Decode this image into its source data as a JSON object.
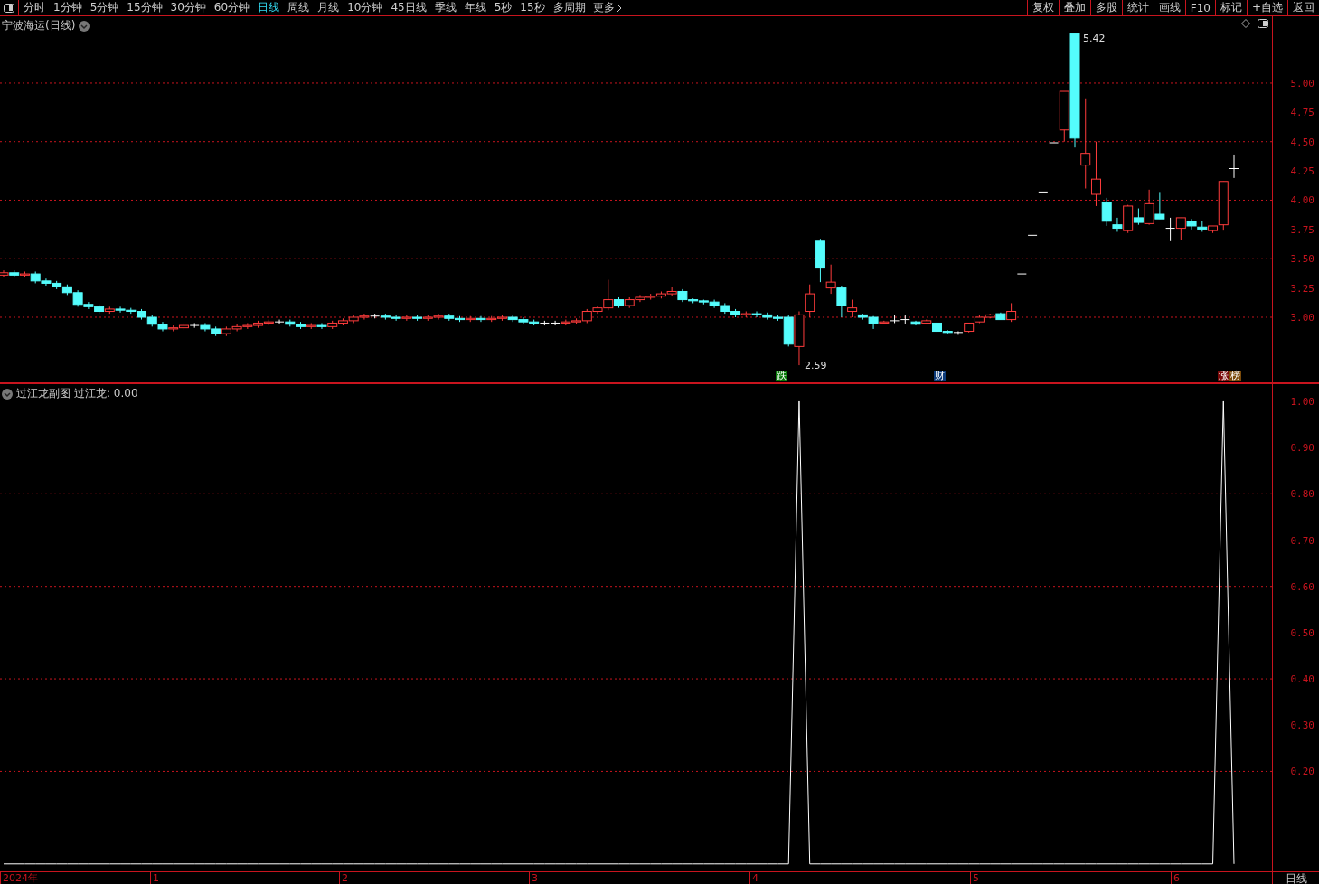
{
  "toolbar": {
    "periods": [
      {
        "label": "分时",
        "selected": false
      },
      {
        "label": "1分钟",
        "selected": false
      },
      {
        "label": "5分钟",
        "selected": false
      },
      {
        "label": "15分钟",
        "selected": false
      },
      {
        "label": "30分钟",
        "selected": false
      },
      {
        "label": "60分钟",
        "selected": false
      },
      {
        "label": "日线",
        "selected": true
      },
      {
        "label": "周线",
        "selected": false
      },
      {
        "label": "月线",
        "selected": false
      },
      {
        "label": "10分钟",
        "selected": false
      },
      {
        "label": "45日线",
        "selected": false
      },
      {
        "label": "季线",
        "selected": false
      },
      {
        "label": "年线",
        "selected": false
      },
      {
        "label": "5秒",
        "selected": false
      },
      {
        "label": "15秒",
        "selected": false
      },
      {
        "label": "多周期",
        "selected": false
      }
    ],
    "more": "更多",
    "actions": [
      "复权",
      "叠加",
      "多股",
      "统计",
      "画线",
      "F10",
      "标记",
      "+自选",
      "返回"
    ]
  },
  "main_chart": {
    "title": "宁波海运(日线)",
    "high_label": "5.42",
    "low_label": "2.59",
    "badges": [
      {
        "parts": [
          {
            "text": "跌",
            "color": "#0a7a0a"
          }
        ]
      },
      {
        "parts": [
          {
            "text": "财",
            "color": "#0c3a7a"
          }
        ]
      },
      {
        "parts": [
          {
            "text": "涨",
            "color": "#7a0a0a"
          },
          {
            "text": "榜",
            "color": "#7a4a0a"
          }
        ]
      }
    ],
    "chart_data": {
      "type": "candlestick",
      "grid": true,
      "ylim": [
        2.444,
        5.571
      ],
      "yticks": [
        {
          "value": 5,
          "label": "5.00"
        },
        {
          "value": 4.75,
          "label": "4.75"
        },
        {
          "value": 4.5,
          "label": "4.50"
        },
        {
          "value": 4.25,
          "label": "4.25"
        },
        {
          "value": 4,
          "label": "4.00"
        },
        {
          "value": 3.75,
          "label": "3.75"
        },
        {
          "value": 3.5,
          "label": "3.50"
        },
        {
          "value": 3.25,
          "label": "3.25"
        },
        {
          "value": 3,
          "label": "3.00"
        }
      ],
      "ohlc": [
        [
          3.36,
          3.4,
          3.34,
          3.38
        ],
        [
          3.38,
          3.4,
          3.34,
          3.36
        ],
        [
          3.36,
          3.39,
          3.34,
          3.37
        ],
        [
          3.37,
          3.39,
          3.29,
          3.31
        ],
        [
          3.31,
          3.33,
          3.27,
          3.29
        ],
        [
          3.29,
          3.31,
          3.24,
          3.26
        ],
        [
          3.26,
          3.28,
          3.19,
          3.21
        ],
        [
          3.21,
          3.23,
          3.09,
          3.11
        ],
        [
          3.11,
          3.13,
          3.07,
          3.09
        ],
        [
          3.09,
          3.11,
          3.03,
          3.05
        ],
        [
          3.05,
          3.09,
          3.03,
          3.07
        ],
        [
          3.07,
          3.09,
          3.04,
          3.06
        ],
        [
          3.06,
          3.08,
          3.03,
          3.05
        ],
        [
          3.05,
          3.07,
          2.98,
          3.0
        ],
        [
          3.0,
          3.02,
          2.92,
          2.94
        ],
        [
          2.94,
          2.96,
          2.88,
          2.9
        ],
        [
          2.9,
          2.93,
          2.88,
          2.91
        ],
        [
          2.91,
          2.95,
          2.89,
          2.93
        ],
        [
          2.93,
          2.95,
          2.91,
          2.93
        ],
        [
          2.93,
          2.95,
          2.88,
          2.9
        ],
        [
          2.9,
          2.92,
          2.84,
          2.86
        ],
        [
          2.86,
          2.92,
          2.84,
          2.9
        ],
        [
          2.9,
          2.94,
          2.88,
          2.92
        ],
        [
          2.92,
          2.95,
          2.9,
          2.93
        ],
        [
          2.93,
          2.97,
          2.91,
          2.95
        ],
        [
          2.95,
          2.98,
          2.93,
          2.96
        ],
        [
          2.96,
          2.98,
          2.94,
          2.96
        ],
        [
          2.96,
          2.98,
          2.92,
          2.94
        ],
        [
          2.94,
          2.96,
          2.9,
          2.92
        ],
        [
          2.92,
          2.95,
          2.9,
          2.93
        ],
        [
          2.93,
          2.95,
          2.9,
          2.92
        ],
        [
          2.92,
          2.97,
          2.9,
          2.95
        ],
        [
          2.95,
          2.99,
          2.93,
          2.97
        ],
        [
          2.97,
          3.02,
          2.95,
          3.0
        ],
        [
          3.0,
          3.03,
          2.98,
          3.01
        ],
        [
          3.01,
          3.03,
          2.99,
          3.01
        ],
        [
          3.01,
          3.03,
          2.98,
          3.0
        ],
        [
          3.0,
          3.02,
          2.97,
          2.99
        ],
        [
          2.99,
          3.02,
          2.97,
          3.0
        ],
        [
          3.0,
          3.02,
          2.97,
          2.99
        ],
        [
          2.99,
          3.02,
          2.97,
          3.0
        ],
        [
          3.0,
          3.03,
          2.98,
          3.01
        ],
        [
          3.01,
          3.03,
          2.97,
          2.99
        ],
        [
          2.99,
          3.01,
          2.96,
          2.98
        ],
        [
          2.98,
          3.01,
          2.96,
          2.99
        ],
        [
          2.99,
          3.01,
          2.96,
          2.98
        ],
        [
          2.98,
          3.01,
          2.96,
          2.99
        ],
        [
          2.99,
          3.02,
          2.97,
          3.0
        ],
        [
          3.0,
          3.02,
          2.96,
          2.98
        ],
        [
          2.98,
          3.0,
          2.94,
          2.96
        ],
        [
          2.96,
          2.98,
          2.93,
          2.95
        ],
        [
          2.95,
          2.97,
          2.93,
          2.95
        ],
        [
          2.95,
          2.97,
          2.93,
          2.95
        ],
        [
          2.95,
          2.98,
          2.93,
          2.96
        ],
        [
          2.96,
          2.99,
          2.94,
          2.97
        ],
        [
          2.97,
          3.07,
          2.95,
          3.05
        ],
        [
          3.05,
          3.1,
          3.03,
          3.08
        ],
        [
          3.08,
          3.32,
          3.06,
          3.15
        ],
        [
          3.15,
          3.17,
          3.08,
          3.1
        ],
        [
          3.1,
          3.17,
          3.08,
          3.15
        ],
        [
          3.15,
          3.19,
          3.13,
          3.17
        ],
        [
          3.17,
          3.2,
          3.15,
          3.18
        ],
        [
          3.18,
          3.22,
          3.16,
          3.2
        ],
        [
          3.2,
          3.26,
          3.18,
          3.22
        ],
        [
          3.22,
          3.24,
          3.13,
          3.15
        ],
        [
          3.15,
          3.16,
          3.12,
          3.14
        ],
        [
          3.14,
          3.15,
          3.11,
          3.13
        ],
        [
          3.13,
          3.15,
          3.08,
          3.1
        ],
        [
          3.1,
          3.12,
          3.03,
          3.05
        ],
        [
          3.05,
          3.07,
          3.0,
          3.02
        ],
        [
          3.02,
          3.05,
          3.0,
          3.03
        ],
        [
          3.03,
          3.05,
          3.0,
          3.02
        ],
        [
          3.02,
          3.04,
          2.98,
          3.0
        ],
        [
          3.0,
          3.02,
          2.97,
          2.99
        ],
        [
          3.0,
          3.02,
          2.75,
          2.77
        ],
        [
          2.75,
          3.05,
          2.59,
          3.02
        ],
        [
          3.05,
          3.28,
          3.0,
          3.2
        ],
        [
          3.65,
          3.67,
          3.3,
          3.42
        ],
        [
          3.25,
          3.45,
          3.2,
          3.3
        ],
        [
          3.25,
          3.27,
          3.0,
          3.1
        ],
        [
          3.05,
          3.15,
          3.0,
          3.08
        ],
        [
          3.02,
          3.03,
          2.98,
          3.0
        ],
        [
          3.0,
          3.01,
          2.9,
          2.95
        ],
        [
          2.95,
          2.97,
          2.94,
          2.96
        ],
        [
          2.97,
          3.02,
          2.95,
          2.97
        ],
        [
          2.98,
          3.02,
          2.94,
          2.98
        ],
        [
          2.96,
          2.97,
          2.93,
          2.94
        ],
        [
          2.95,
          2.98,
          2.94,
          2.97
        ],
        [
          2.95,
          2.96,
          2.87,
          2.88
        ],
        [
          2.88,
          2.89,
          2.86,
          2.87
        ],
        [
          2.87,
          2.88,
          2.85,
          2.87
        ],
        [
          2.88,
          2.95,
          2.87,
          2.95
        ],
        [
          2.96,
          3.02,
          2.95,
          3.0
        ],
        [
          3.0,
          3.03,
          2.99,
          3.02
        ],
        [
          3.03,
          3.04,
          2.98,
          2.98
        ],
        [
          2.98,
          3.12,
          2.96,
          3.05
        ],
        [
          3.37,
          3.37,
          3.37,
          3.37
        ],
        [
          3.7,
          3.7,
          3.7,
          3.7
        ],
        [
          4.07,
          4.07,
          4.07,
          4.07
        ],
        [
          4.49,
          4.49,
          4.49,
          4.49
        ],
        [
          4.6,
          4.93,
          4.5,
          4.93
        ],
        [
          5.42,
          5.42,
          4.45,
          4.53
        ],
        [
          4.3,
          4.87,
          4.1,
          4.4
        ],
        [
          4.05,
          4.5,
          3.95,
          4.18
        ],
        [
          3.98,
          4.02,
          3.78,
          3.82
        ],
        [
          3.79,
          3.85,
          3.73,
          3.76
        ],
        [
          3.74,
          3.96,
          3.72,
          3.95
        ],
        [
          3.85,
          3.93,
          3.79,
          3.81
        ],
        [
          3.8,
          4.09,
          3.79,
          3.97
        ],
        [
          3.88,
          4.07,
          3.84,
          3.84
        ],
        [
          3.76,
          3.85,
          3.65,
          3.76
        ],
        [
          3.76,
          3.85,
          3.66,
          3.85
        ],
        [
          3.82,
          3.84,
          3.75,
          3.78
        ],
        [
          3.77,
          3.82,
          3.73,
          3.75
        ],
        [
          3.74,
          3.78,
          3.72,
          3.78
        ],
        [
          3.79,
          4.16,
          3.74,
          4.16
        ],
        [
          4.27,
          4.39,
          4.19,
          4.27
        ]
      ]
    }
  },
  "sub_chart": {
    "title": "过江龙副图",
    "reading": ": 0.00",
    "chart_data": {
      "type": "line",
      "grid": true,
      "ylim": [
        -0.016,
        1.037
      ],
      "yticks": [
        {
          "value": 1,
          "label": "1.00"
        },
        {
          "value": 0.9,
          "label": "0.90"
        },
        {
          "value": 0.8,
          "label": "0.80"
        },
        {
          "value": 0.7,
          "label": "0.70"
        },
        {
          "value": 0.6,
          "label": "0.60"
        },
        {
          "value": 0.5,
          "label": "0.50"
        },
        {
          "value": 0.4,
          "label": "0.40"
        },
        {
          "value": 0.3,
          "label": "0.30"
        },
        {
          "value": 0.2,
          "label": "0.20"
        }
      ],
      "series": [
        {
          "name": "过江龙",
          "color": "#ffffff",
          "values": [
            0,
            0,
            0,
            0,
            0,
            0,
            0,
            0,
            0,
            0,
            0,
            0,
            0,
            0,
            0,
            0,
            0,
            0,
            0,
            0,
            0,
            0,
            0,
            0,
            0,
            0,
            0,
            0,
            0,
            0,
            0,
            0,
            0,
            0,
            0,
            0,
            0,
            0,
            0,
            0,
            0,
            0,
            0,
            0,
            0,
            0,
            0,
            0,
            0,
            0,
            0,
            0,
            0,
            0,
            0,
            0,
            0,
            0,
            0,
            0,
            0,
            0,
            0,
            0,
            0,
            0,
            0,
            0,
            0,
            0,
            0,
            0,
            0,
            0,
            0,
            1,
            0,
            0,
            0,
            0,
            0,
            0,
            0,
            0,
            0,
            0,
            0,
            0,
            0,
            0,
            0,
            0,
            0,
            0,
            0,
            0,
            0,
            0,
            0,
            0,
            0,
            0,
            0,
            0,
            0,
            0,
            0,
            0,
            0,
            0,
            0,
            0,
            0,
            0,
            0,
            1,
            0
          ]
        }
      ]
    }
  },
  "x_axis": {
    "labels": [
      "2024年",
      "1",
      "2",
      "3",
      "4",
      "5",
      "6"
    ],
    "period": "日线"
  }
}
